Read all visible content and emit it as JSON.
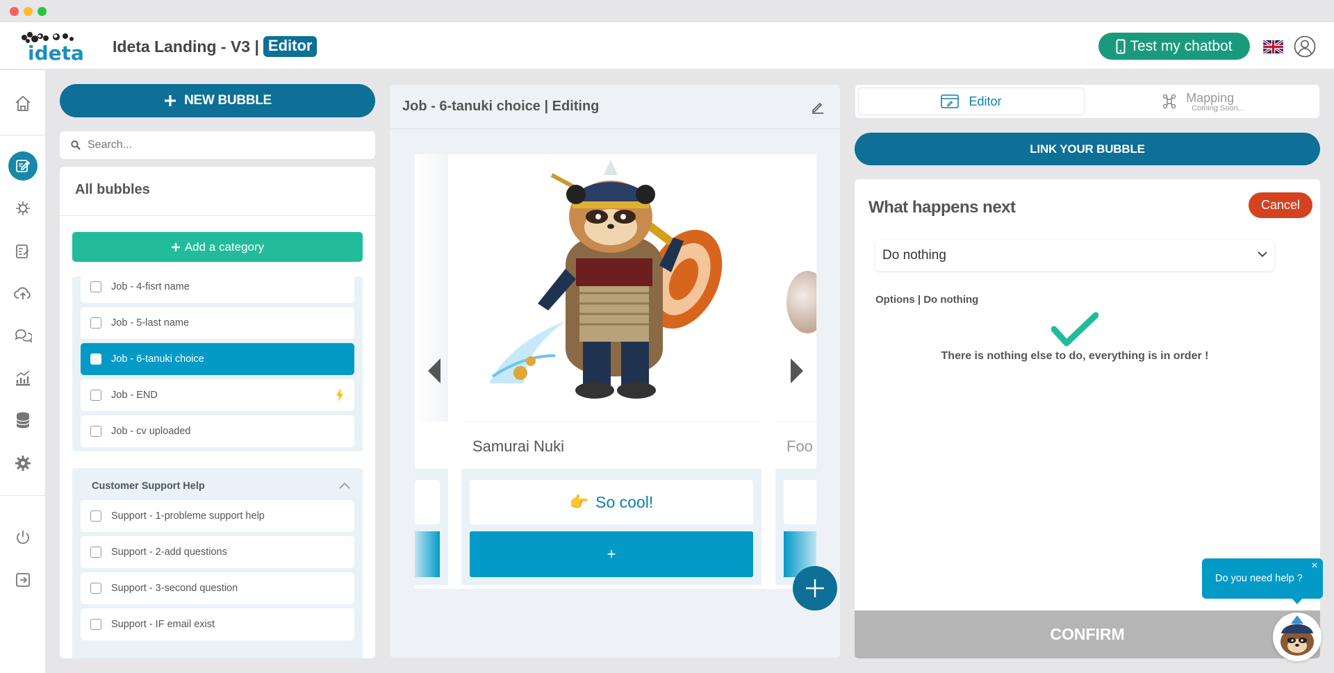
{
  "app": {
    "title": "Ideta Landing - V3 |",
    "mode_badge": "Editor",
    "test_button": "Test my chatbot",
    "logo_text": "ideta"
  },
  "colors": {
    "brand_dark": "#0e6f97",
    "brand_light": "#039ac8",
    "green": "#22bc9a",
    "test_green": "#1a9a7c",
    "cancel_red": "#d4421f",
    "confirm_grey": "#b5b5b5"
  },
  "nav": {
    "items": [
      "home-icon",
      "edit-bubbles-icon",
      "ai-icon",
      "form-icon",
      "cloud-upload-icon",
      "chat-icon",
      "analytics-icon",
      "database-icon",
      "settings-icon",
      "power-icon",
      "exit-icon"
    ],
    "active": "edit-bubbles-icon"
  },
  "left": {
    "new_bubble": "NEW BUBBLE",
    "search_placeholder": "Search...",
    "panel_title": "All bubbles",
    "add_category": "Add a category",
    "job_items": [
      {
        "label": "Job - 4-fisrt name"
      },
      {
        "label": "Job - 5-last name"
      },
      {
        "label": "Job - 6-tanuki choice",
        "active": true
      },
      {
        "label": "Job - END",
        "icon": "bolt-icon"
      },
      {
        "label": "Job - cv uploaded"
      }
    ],
    "support_category": {
      "title": "Customer Support Help",
      "items": [
        {
          "label": "Support - 1-probleme support help"
        },
        {
          "label": "Support - 2-add questions"
        },
        {
          "label": "Support - 3-second question"
        },
        {
          "label": "Support - IF email exist"
        }
      ]
    }
  },
  "center": {
    "title": "Job - 6-tanuki choice  | Editing",
    "card_title": "Samurai Nuki",
    "next_card_title": "Foo",
    "button_label": "So cool!",
    "button_emoji": "👉",
    "add_label": "+"
  },
  "right": {
    "tab_editor": "Editor",
    "tab_mapping": "Mapping",
    "tab_mapping_sub": "Coming Soon...",
    "link_button": "LINK YOUR BUBBLE",
    "next_title": "What happens next",
    "cancel": "Cancel",
    "select_value": "Do nothing",
    "options_label": "Options | Do nothing",
    "ok_text": "There is nothing else to do, everything is in order !",
    "confirm": "CONFIRM"
  },
  "help": {
    "text": "Do you need help ?",
    "close": "×"
  }
}
